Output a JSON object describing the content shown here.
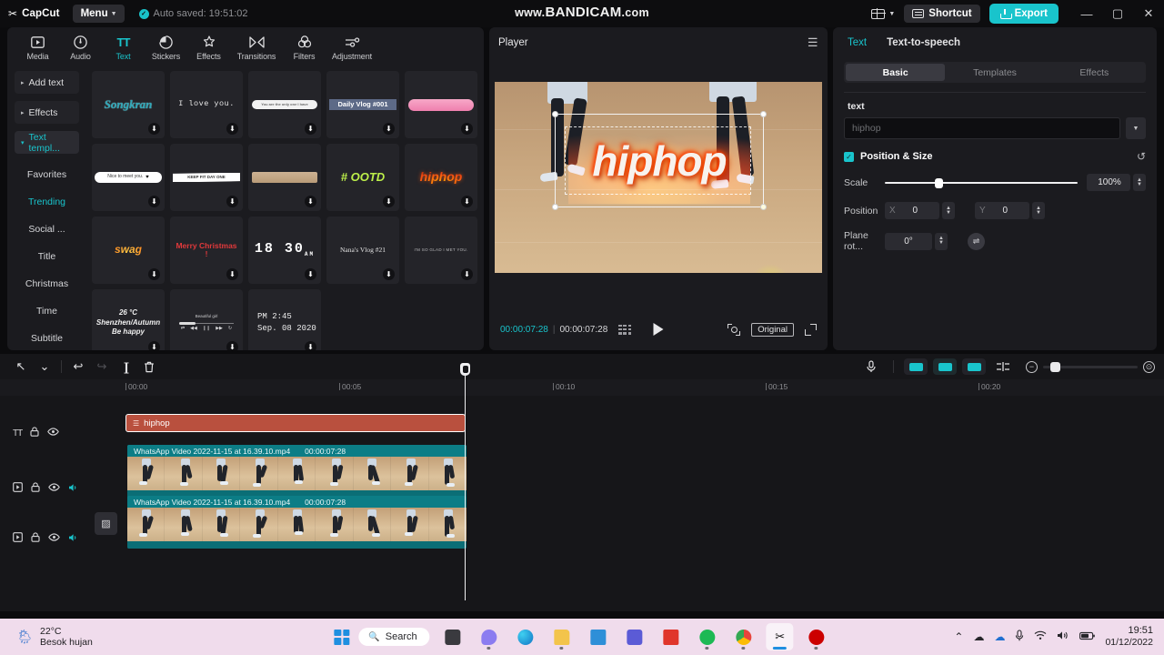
{
  "titlebar": {
    "brand": "CapCut",
    "brand_glyph": "✂",
    "menu_label": "Menu",
    "autosave_text": "Auto saved: 19:51:02",
    "watermark_www": "www.",
    "watermark_main": "BANDICAM",
    "watermark_com": ".com",
    "shortcut_label": "Shortcut",
    "export_label": "Export",
    "minimize_glyph": "—",
    "maximize_glyph": "▢",
    "close_glyph": "✕",
    "accent_color": "#19c4cc"
  },
  "tooltabs": [
    {
      "label": "Media",
      "icon": "media-icon",
      "glyph": "▶",
      "active": false
    },
    {
      "label": "Audio",
      "icon": "audio-icon",
      "glyph": "♪",
      "active": false
    },
    {
      "label": "Text",
      "icon": "text-icon",
      "glyph": "TT",
      "active": true
    },
    {
      "label": "Stickers",
      "icon": "stickers-icon",
      "glyph": "◔",
      "active": false
    },
    {
      "label": "Effects",
      "icon": "effects-icon",
      "glyph": "✦",
      "active": false
    },
    {
      "label": "Transitions",
      "icon": "transitions-icon",
      "glyph": "⋈",
      "active": false
    },
    {
      "label": "Filters",
      "icon": "filters-icon",
      "glyph": "◎",
      "active": false
    },
    {
      "label": "Adjustment",
      "icon": "adjustment-icon",
      "glyph": "⚌",
      "active": false
    }
  ],
  "leftnav": {
    "groups": [
      {
        "label": "Add text",
        "selected": false
      },
      {
        "label": "Effects",
        "selected": false
      },
      {
        "label": "Text templ...",
        "selected": true
      }
    ],
    "subitems": [
      {
        "label": "Favorites",
        "active": false
      },
      {
        "label": "Trending",
        "active": true
      },
      {
        "label": "Social ...",
        "active": false
      },
      {
        "label": "Title",
        "active": false
      },
      {
        "label": "Christmas",
        "active": false
      },
      {
        "label": "Time",
        "active": false
      },
      {
        "label": "Subtitle",
        "active": false
      }
    ]
  },
  "templates": [
    {
      "name": "songkran",
      "preview": "Songkran",
      "download": "⬇"
    },
    {
      "name": "i-love-you",
      "preview": "I love you.",
      "download": "⬇"
    },
    {
      "name": "white-brush",
      "preview": "You are the only one I have",
      "download": "⬇"
    },
    {
      "name": "daily-vlog",
      "preview": "Daily Vlog #001",
      "download": "⬇"
    },
    {
      "name": "pink-brush",
      "preview": "",
      "download": "⬇"
    },
    {
      "name": "nice-to-meet",
      "preview": "Nice to meet you.",
      "download": "⬇"
    },
    {
      "name": "keep-fit",
      "preview": "KEEP FIT DAY ONE",
      "download": "⬇"
    },
    {
      "name": "tan-brush",
      "preview": "",
      "download": "⬇"
    },
    {
      "name": "ootd",
      "preview": "# OOTD",
      "download": "⬇"
    },
    {
      "name": "hiphop",
      "preview": "hiphop",
      "download": "⬇"
    },
    {
      "name": "swag",
      "preview": "swag",
      "download": "⬇"
    },
    {
      "name": "merry-christmas",
      "preview": "Merry Christmas !",
      "download": "⬇"
    },
    {
      "name": "clock-1830",
      "preview": "18 30",
      "preview_sub": "AM",
      "download": "⬇"
    },
    {
      "name": "nanas-vlog",
      "preview": "Nana's Vlog #21",
      "download": "⬇"
    },
    {
      "name": "im-so-glad",
      "preview": "I'M SO GLAD I MET YOU.",
      "download": "⬇"
    },
    {
      "name": "weather-26c",
      "preview_l1": "26 °C",
      "preview_l2": "Shenzhen/Autumn",
      "preview_l3": "Be happy",
      "download": "⬇"
    },
    {
      "name": "music-player",
      "preview": "Beautiful girl",
      "download": "⬇"
    },
    {
      "name": "date-pm245",
      "preview_l1": "PM 2:45",
      "preview_l2": "Sep. 08  2020",
      "download": "⬇"
    }
  ],
  "player": {
    "title": "Player",
    "menu_glyph": "☰",
    "overlay_text": "hiphop",
    "current_time": "00:00:07:28",
    "total_time": "00:00:07:28",
    "separator": "|",
    "play_label": "play",
    "quality_label": "Original",
    "rotate_glyph": "↻"
  },
  "rightpanel": {
    "tabs": [
      {
        "label": "Text",
        "active": true
      },
      {
        "label": "Text-to-speech",
        "active": false
      }
    ],
    "segments": [
      {
        "label": "Basic",
        "active": true
      },
      {
        "label": "Templates",
        "active": false
      },
      {
        "label": "Effects",
        "active": false
      }
    ],
    "text_label": "text",
    "text_value": "hiphop",
    "dropdown_glyph": "▼",
    "section_title": "Position & Size",
    "section_checked_glyph": "✓",
    "reset_glyph": "↺",
    "scale_label": "Scale",
    "scale_value": "100%",
    "position_label": "Position",
    "position_x_axis": "X",
    "position_x_value": "0",
    "position_y_axis": "Y",
    "position_y_value": "0",
    "rotation_label": "Plane rot...",
    "rotation_value": "0°",
    "rotation_button_glyph": "⇌",
    "spinner_up": "▲",
    "spinner_down": "▼"
  },
  "timeline": {
    "tools": [
      {
        "name": "select-tool",
        "glyph": "↖"
      },
      {
        "name": "select-dropdown",
        "glyph": "⌄"
      },
      {
        "name": "undo",
        "glyph": "↩"
      },
      {
        "name": "redo",
        "glyph": "↪"
      },
      {
        "name": "split",
        "glyph": "]["
      },
      {
        "name": "delete",
        "glyph": "🗑"
      }
    ],
    "right_tools": [
      {
        "name": "record-voiceover-icon",
        "glyph": "🎤"
      },
      {
        "name": "mirror-icon",
        "glyph": ""
      },
      {
        "name": "freeze-icon",
        "glyph": ""
      },
      {
        "name": "crop-icon",
        "glyph": ""
      },
      {
        "name": "split-clip-icon",
        "glyph": ""
      },
      {
        "name": "zoom-out-icon",
        "glyph": "−"
      },
      {
        "name": "zoom-fit-icon",
        "glyph": "⊙"
      }
    ],
    "ruler_ticks": [
      "00:00",
      "00:05",
      "00:10",
      "00:15",
      "00:20"
    ],
    "tracks": [
      {
        "name": "text-track",
        "type": "text",
        "icon": "TT",
        "lock_glyph": "🔒",
        "eye_glyph": "👁",
        "clip_label": "hiphop",
        "clip_badge": "☰"
      },
      {
        "name": "video-track-1",
        "type": "video",
        "icon": "▣",
        "lock_glyph": "🔒",
        "eye_glyph": "👁",
        "mute_glyph": "🔊",
        "clip_label": "WhatsApp Video 2022-11-15 at 16.39.10.mp4",
        "clip_duration": "00:00:07:28"
      },
      {
        "name": "video-track-2",
        "type": "video",
        "icon": "▣",
        "lock_glyph": "🔒",
        "eye_glyph": "👁",
        "mute_glyph": "🔊",
        "clip_label": "WhatsApp Video 2022-11-15 at 16.39.10.mp4",
        "clip_duration": "00:00:07:28"
      }
    ],
    "mask_button_glyph": "▨"
  },
  "taskbar": {
    "weather_temp": "22°C",
    "weather_desc": "Besok hujan",
    "weather_icon": "🌦",
    "search_label": "Search",
    "search_icon": "search-icon",
    "apps": [
      {
        "name": "file-explorer-dark-icon",
        "color": "#3a3a3f"
      },
      {
        "name": "chat-icon",
        "color": "#8b7cf0"
      },
      {
        "name": "edge-icon",
        "color": "#2aa8e0"
      },
      {
        "name": "file-explorer-icon",
        "color": "#f3c44b"
      },
      {
        "name": "mail-icon",
        "color": "#2e8fd8"
      },
      {
        "name": "music-app-icon",
        "color": "#5b5bd6"
      },
      {
        "name": "office-icon",
        "color": "#e0352b"
      },
      {
        "name": "spotify-icon",
        "color": "#1db954"
      },
      {
        "name": "chrome-icon",
        "color": "#e8453c"
      },
      {
        "name": "capcut-icon",
        "color": "#ffffff"
      },
      {
        "name": "recorder-icon",
        "color": "#cc0000"
      }
    ],
    "tray": [
      {
        "name": "chevron-up-icon",
        "glyph": "⌃"
      },
      {
        "name": "cloud-sync-icon",
        "glyph": "☁"
      },
      {
        "name": "onedrive-icon",
        "glyph": "☁"
      },
      {
        "name": "microphone-icon",
        "glyph": "🎤"
      },
      {
        "name": "wifi-icon",
        "glyph": "📶"
      },
      {
        "name": "volume-icon",
        "glyph": "🔊"
      },
      {
        "name": "battery-icon",
        "glyph": "🔋"
      }
    ],
    "clock_time": "19:51",
    "clock_date": "01/12/2022"
  }
}
